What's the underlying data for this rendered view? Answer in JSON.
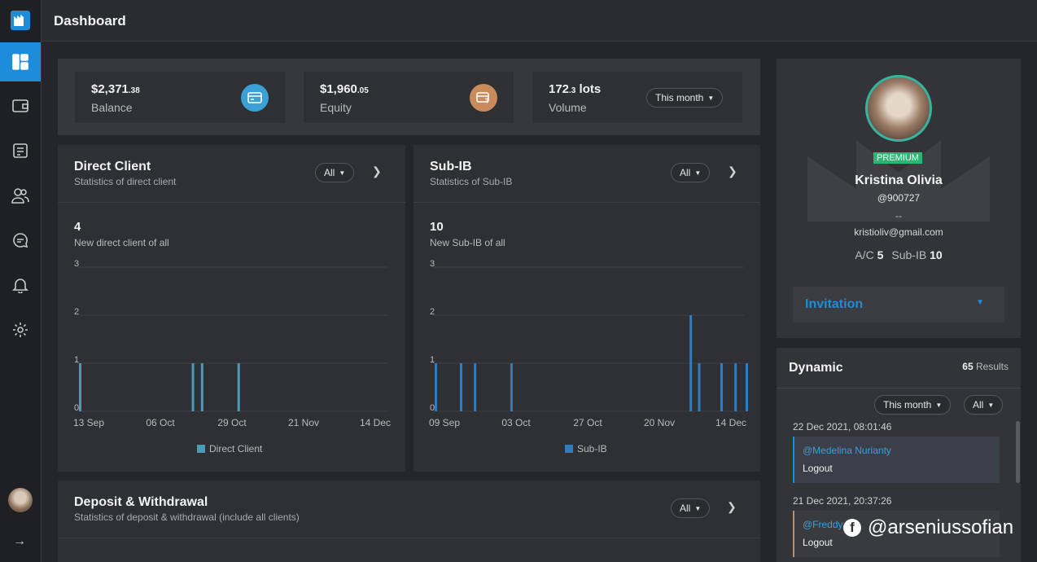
{
  "header": {
    "title": "Dashboard"
  },
  "sidebar": {
    "items": [
      {
        "icon": "dashboard-icon",
        "active": true
      },
      {
        "icon": "wallet-icon"
      },
      {
        "icon": "document-icon"
      },
      {
        "icon": "users-icon"
      },
      {
        "icon": "chat-icon"
      },
      {
        "icon": "bell-icon"
      },
      {
        "icon": "gear-icon"
      }
    ],
    "expand_icon": "→"
  },
  "stats": {
    "balance": {
      "value": "$2,371",
      "cents": ".38",
      "label": "Balance"
    },
    "equity": {
      "value": "$1,960",
      "cents": ".05",
      "label": "Equity"
    },
    "volume": {
      "value": "172",
      "decimal": ".3",
      "unit": " lots",
      "label": "Volume"
    },
    "period": "This month"
  },
  "direct_client": {
    "title": "Direct Client",
    "subtitle": "Statistics of direct client",
    "filter": "All",
    "count": "4",
    "count_label": "New direct client of all",
    "legend": "Direct Client"
  },
  "sub_ib": {
    "title": "Sub-IB",
    "subtitle": "Statistics of Sub-IB",
    "filter": "All",
    "count": "10",
    "count_label": "New Sub-IB of all",
    "legend": "Sub-IB"
  },
  "deposit": {
    "title": "Deposit & Withdrawal",
    "subtitle": "Statistics of deposit & withdrawal (include all clients)",
    "filter": "All"
  },
  "profile": {
    "badge": "PREMIUM",
    "name": "Kristina Olivia",
    "handle": "@900727",
    "dash": "--",
    "email": "kristioliv@gmail.com",
    "ac_label": "A/C",
    "ac_value": "5",
    "subib_label": "Sub-IB",
    "subib_value": "10",
    "invitation": "Invitation"
  },
  "dynamic": {
    "title": "Dynamic",
    "count": "65",
    "count_label": " Results",
    "period": "This month",
    "filter": "All",
    "events": [
      {
        "time": "22 Dec 2021, 08:01:46",
        "user": "@Medelina Nurianty",
        "action": "Logout"
      },
      {
        "time": "21 Dec 2021, 20:37:26",
        "user": "@Freddy",
        "action": "Logout"
      }
    ]
  },
  "watermark": "@arseniussofian",
  "chart_data": [
    {
      "type": "bar",
      "name": "Direct Client",
      "color": "#4a9bb8",
      "x_ticks": [
        "13 Sep",
        "06 Oct",
        "29 Oct",
        "21 Nov",
        "14 Dec"
      ],
      "x_start": "2021-09-13",
      "x_end": "2021-12-24",
      "y_ticks": [
        0,
        1,
        2,
        3
      ],
      "ylim": [
        0,
        3
      ],
      "points": [
        {
          "x": "2021-09-13",
          "y": 1
        },
        {
          "x": "2021-10-20",
          "y": 1
        },
        {
          "x": "2021-10-23",
          "y": 1
        },
        {
          "x": "2021-11-04",
          "y": 1
        }
      ]
    },
    {
      "type": "bar",
      "name": "Sub-IB",
      "color": "#2c7dc5",
      "x_ticks": [
        "09 Sep",
        "03 Oct",
        "27 Oct",
        "20 Nov",
        "14 Dec"
      ],
      "x_start": "2021-09-09",
      "x_end": "2021-12-29",
      "y_ticks": [
        0,
        1,
        2,
        3
      ],
      "ylim": [
        0,
        3
      ],
      "points": [
        {
          "x": "2021-09-09",
          "y": 1
        },
        {
          "x": "2021-09-18",
          "y": 1
        },
        {
          "x": "2021-09-23",
          "y": 1
        },
        {
          "x": "2021-10-06",
          "y": 1
        },
        {
          "x": "2021-12-09",
          "y": 2
        },
        {
          "x": "2021-12-12",
          "y": 1
        },
        {
          "x": "2021-12-20",
          "y": 1
        },
        {
          "x": "2021-12-25",
          "y": 1
        },
        {
          "x": "2021-12-29",
          "y": 1
        }
      ]
    }
  ]
}
